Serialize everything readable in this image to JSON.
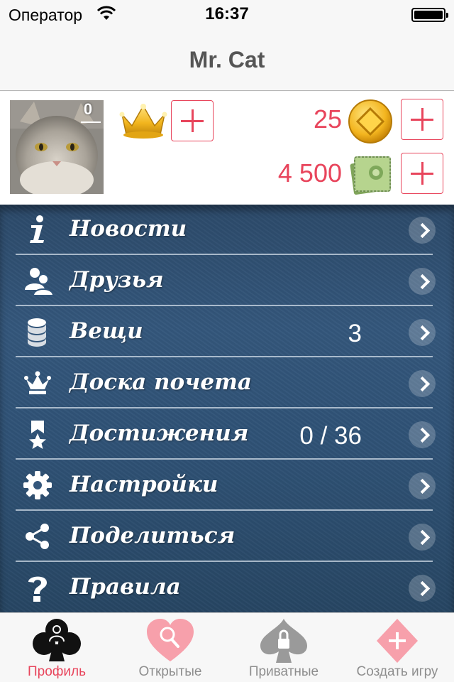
{
  "status_bar": {
    "carrier": "Оператор",
    "time": "16:37"
  },
  "nav_bar": {
    "title": "Mr. Cat"
  },
  "profile": {
    "level": "0",
    "coins": "25",
    "money": "4 500"
  },
  "menu": {
    "items": [
      {
        "label": "Новости",
        "icon": "info-icon",
        "value": ""
      },
      {
        "label": "Друзья",
        "icon": "friends-icon",
        "value": ""
      },
      {
        "label": "Вещи",
        "icon": "coins-stack-icon",
        "value": "3"
      },
      {
        "label": "Доска почета",
        "icon": "crown-icon",
        "value": ""
      },
      {
        "label": "Достижения",
        "icon": "medal-icon",
        "value": "0 / 36"
      },
      {
        "label": "Настройки",
        "icon": "gear-icon",
        "value": ""
      },
      {
        "label": "Поделиться",
        "icon": "share-icon",
        "value": ""
      },
      {
        "label": "Правила",
        "icon": "question-icon",
        "value": ""
      }
    ]
  },
  "tab_bar": {
    "tabs": [
      {
        "label": "Профиль",
        "icon": "club-profile-icon",
        "active": true
      },
      {
        "label": "Открытые",
        "icon": "heart-search-icon",
        "active": false
      },
      {
        "label": "Приватные",
        "icon": "spade-lock-icon",
        "active": false
      },
      {
        "label": "Создать игру",
        "icon": "diamond-plus-icon",
        "active": false
      }
    ]
  },
  "colors": {
    "accent": "#e8455c",
    "menu_background": "#34577c",
    "tab_inactive": "#8e8e8e"
  }
}
